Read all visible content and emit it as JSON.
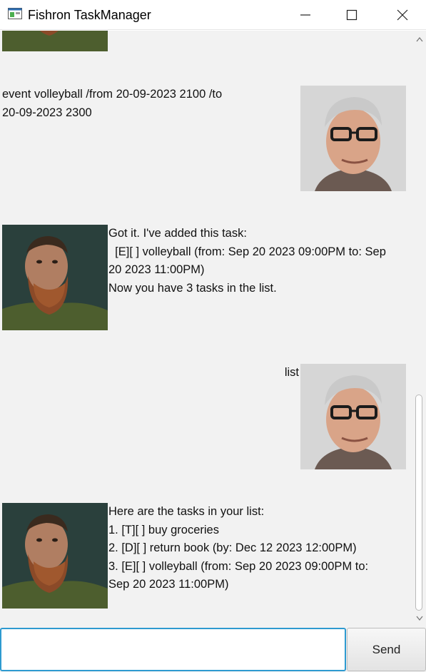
{
  "window": {
    "title": "Fishron TaskManager"
  },
  "icons": {
    "app": "app-window-icon",
    "minimize": "minimize-icon",
    "maximize": "maximize-icon",
    "close": "close-icon"
  },
  "colors": {
    "chat_background": "#f2f2f2",
    "input_focus_border": "#2e9ad0"
  },
  "messages": [
    {
      "sender": "bot",
      "text": ""
    },
    {
      "sender": "user",
      "text": "event volleyball /from 20-09-2023 2100 /to\n20-09-2023 2300"
    },
    {
      "sender": "bot",
      "text": "Got it. I've added this task:\n  [E][ ] volleyball (from: Sep 20 2023 09:00PM to: Sep\n20 2023 11:00PM)\nNow you have 3 tasks in the list."
    },
    {
      "sender": "user",
      "text": "list"
    },
    {
      "sender": "bot",
      "text": "Here are the tasks in your list:\n1. [T][ ] buy groceries\n2. [D][ ] return book (by: Dec 12 2023 12:00PM)\n3. [E][ ] volleyball (from: Sep 20 2023 09:00PM to:\nSep 20 2023 11:00PM)"
    }
  ],
  "input": {
    "value": "",
    "placeholder": ""
  },
  "send_button": {
    "label": "Send"
  }
}
